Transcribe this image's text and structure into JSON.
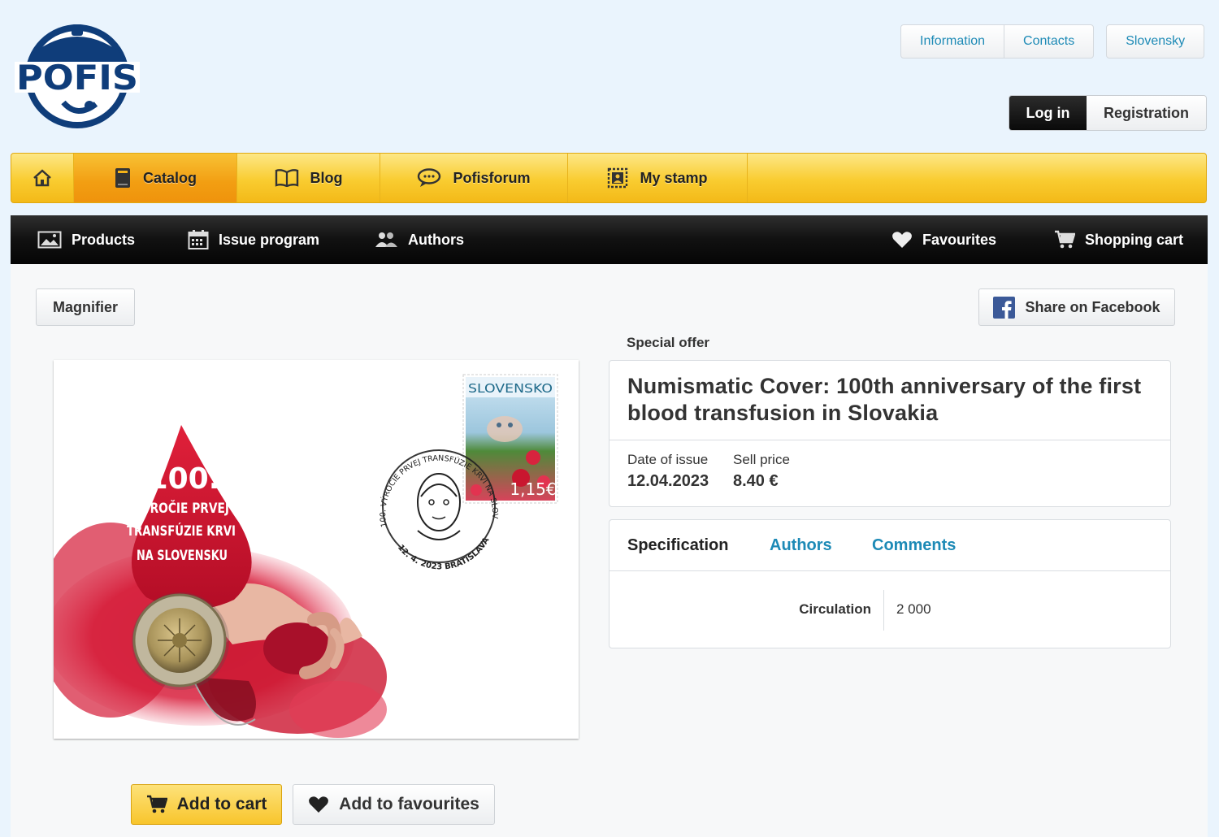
{
  "brand": {
    "logo_text": "POFIS",
    "color": "#0f3d7a"
  },
  "top_links": {
    "information": "Information",
    "contacts": "Contacts",
    "language": "Slovensky"
  },
  "auth": {
    "login": "Log in",
    "register": "Registration"
  },
  "main_nav": {
    "home_icon": "home-icon",
    "items": [
      {
        "label": "Catalog",
        "icon": "book-icon",
        "active": true
      },
      {
        "label": "Blog",
        "icon": "open-book-icon",
        "active": false
      },
      {
        "label": "Pofisforum",
        "icon": "speech-bubble-icon",
        "active": false
      },
      {
        "label": "My stamp",
        "icon": "stamp-frame-icon",
        "active": false
      }
    ]
  },
  "sub_nav": {
    "products": "Products",
    "issue_program": "Issue program",
    "authors": "Authors",
    "favourites": "Favourites",
    "shopping_cart": "Shopping cart"
  },
  "toolbar": {
    "magnifier": "Magnifier",
    "share_facebook": "Share on Facebook"
  },
  "product": {
    "badge": "Special offer",
    "title": "Numismatic Cover: 100th anniversary of the first blood transfusion in Slovakia",
    "date_label": "Date of issue",
    "date_value": "12.04.2023",
    "price_label": "Sell price",
    "price_value": "8.40 €"
  },
  "tabs": {
    "specification": "Specification",
    "authors": "Authors",
    "comments": "Comments"
  },
  "specification": {
    "circulation_label": "Circulation",
    "circulation_value": "2 000"
  },
  "image": {
    "drop_line1": "100.",
    "drop_line2": "VÝROČIE PRVEJ",
    "drop_line3": "TRANSFÚZIE KRVI",
    "drop_line4": "NA SLOVENSKU",
    "stamp_country": "SLOVENSKO",
    "stamp_value": "1,15€",
    "postmark_text": "100. VÝROČIE PRVEJ TRANSFÚZIE KRVI NA SLOVENSKU · PROF. JÁN KŇAZOVICKÝ",
    "postmark_date": "12. 4. 2023 BRATISLAVA 1"
  },
  "actions": {
    "add_to_cart": "Add to cart",
    "add_to_favourites": "Add to favourites"
  }
}
